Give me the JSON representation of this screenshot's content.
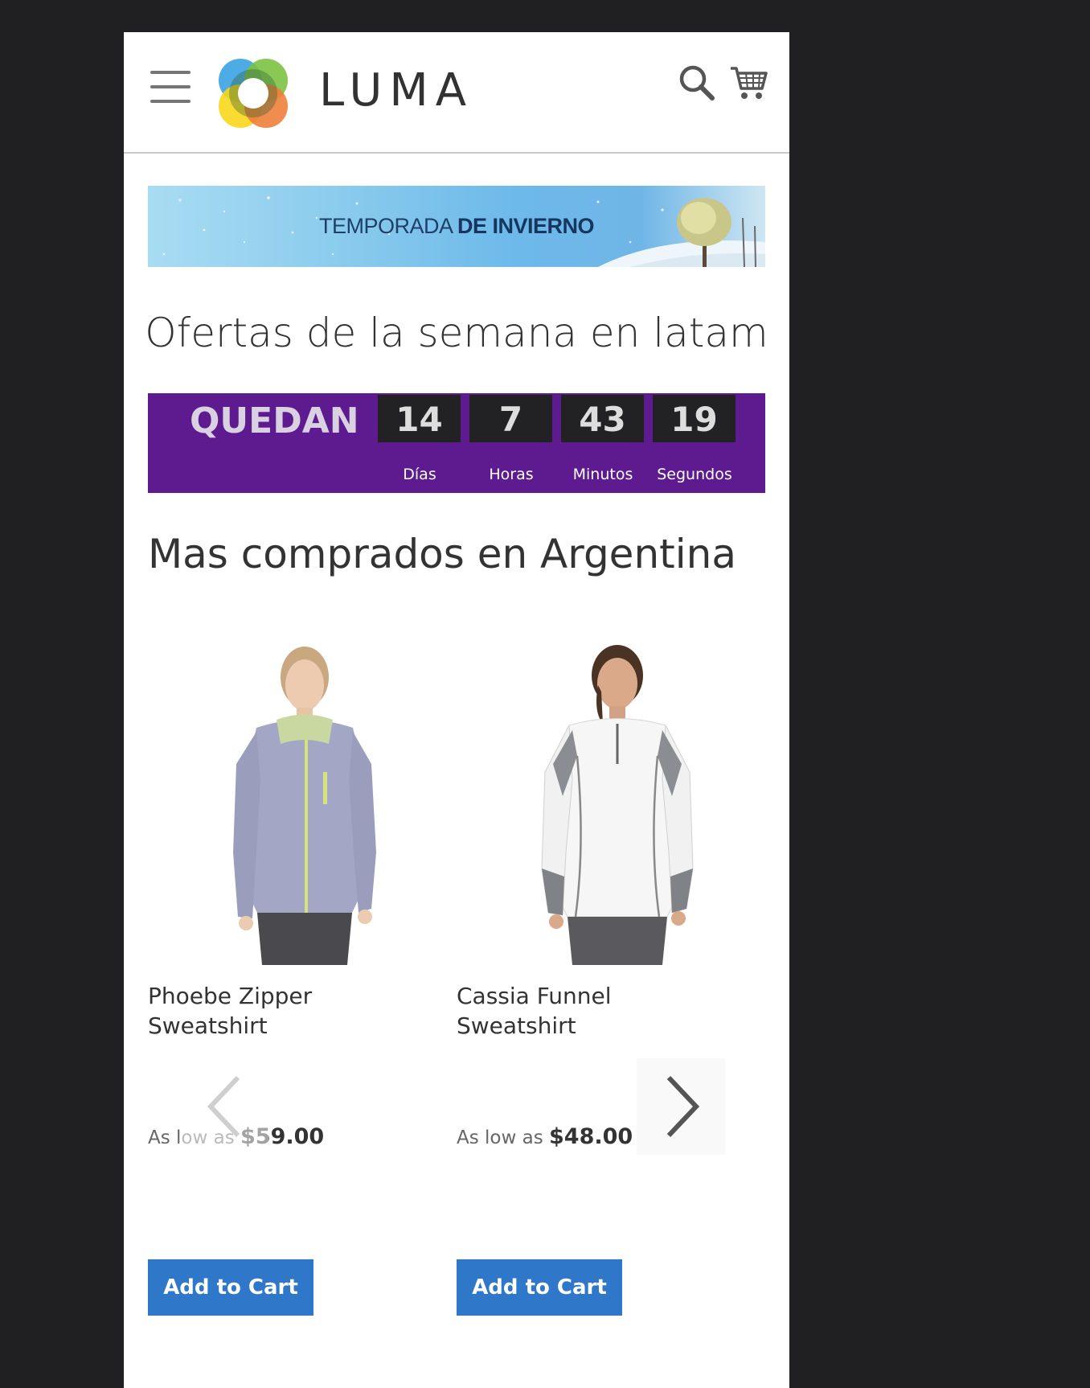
{
  "header": {
    "logo_text": "LUMA"
  },
  "banner": {
    "text_light": "TEMPORADA ",
    "text_bold": "DE INVIERNO"
  },
  "offers": {
    "title": "Ofertas de la semana en latam",
    "countdown": {
      "lead": "QUEDAN",
      "units": [
        {
          "value": "14",
          "label": "Días"
        },
        {
          "value": "7",
          "label": "Horas"
        },
        {
          "value": "43",
          "label": "Minutos"
        },
        {
          "value": "19",
          "label": "Segundos"
        }
      ]
    }
  },
  "best_sellers": {
    "title": "Mas comprados en Argentina",
    "products": [
      {
        "name": "Phoebe Zipper Sweatshirt",
        "price_prefix": "As low as ",
        "price": "$59.00",
        "button": "Add to Cart"
      },
      {
        "name": "Cassia Funnel Sweatshirt",
        "price_prefix": "As low as ",
        "price": "$48.00",
        "button": "Add to Cart"
      }
    ]
  },
  "icons": {
    "menu": "hamburger-menu-icon",
    "search": "search-icon",
    "cart": "cart-icon",
    "prev": "chevron-left-icon",
    "next": "chevron-right-icon"
  },
  "colors": {
    "countdown_bg": "#5d1b8f",
    "button_bg": "#2f77c8",
    "page_bg": "#202022"
  }
}
